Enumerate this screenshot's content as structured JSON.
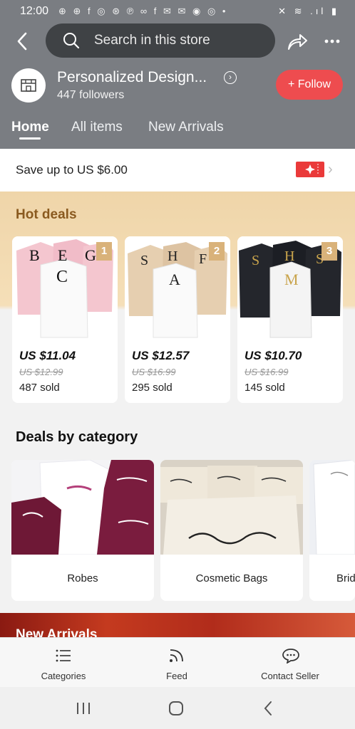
{
  "status_bar": {
    "time": "12:00",
    "notification_icons": "⊕ ⊕ f ◎ ⊛ ℗ ∞ f ✉ ✉ ◉ ◎ •",
    "system_icons": "✕ ≋ .ıl ▮"
  },
  "search": {
    "placeholder": "Search in this store"
  },
  "store": {
    "name": "Personalized Design...",
    "followers": "447 followers",
    "follow_label": "+ Follow"
  },
  "tabs": [
    {
      "label": "Home"
    },
    {
      "label": "All items"
    },
    {
      "label": "New Arrivals"
    }
  ],
  "coupon": {
    "text": "Save up to US $6.00"
  },
  "hot_deals": {
    "title": "Hot deals",
    "items": [
      {
        "rank": "1",
        "price": "US $11.04",
        "old_price": "US $12.99",
        "sold": "487 sold",
        "letters": [
          "B",
          "E",
          "G",
          "C"
        ],
        "tone": "#f4c6cf"
      },
      {
        "rank": "2",
        "price": "US $12.57",
        "old_price": "US $16.99",
        "sold": "295 sold",
        "letters": [
          "S",
          "H",
          "F",
          "A"
        ],
        "tone": "#e6cfb0"
      },
      {
        "rank": "3",
        "price": "US $10.70",
        "old_price": "US $16.99",
        "sold": "145 sold",
        "letters": [
          "S",
          "H",
          "S",
          "M"
        ],
        "tone": "#24262c"
      }
    ]
  },
  "categories": {
    "title": "Deals by category",
    "items": [
      {
        "label": "Robes"
      },
      {
        "label": "Cosmetic Bags"
      },
      {
        "label": "Brid"
      }
    ]
  },
  "new_arrivals": {
    "title": "New Arrivals"
  },
  "bottom_nav": [
    {
      "label": "Categories"
    },
    {
      "label": "Feed"
    },
    {
      "label": "Contact Seller"
    }
  ],
  "colors": {
    "header": "#7a7d82",
    "accent": "#ee4c4f",
    "hot_title": "#8a5a1f"
  }
}
